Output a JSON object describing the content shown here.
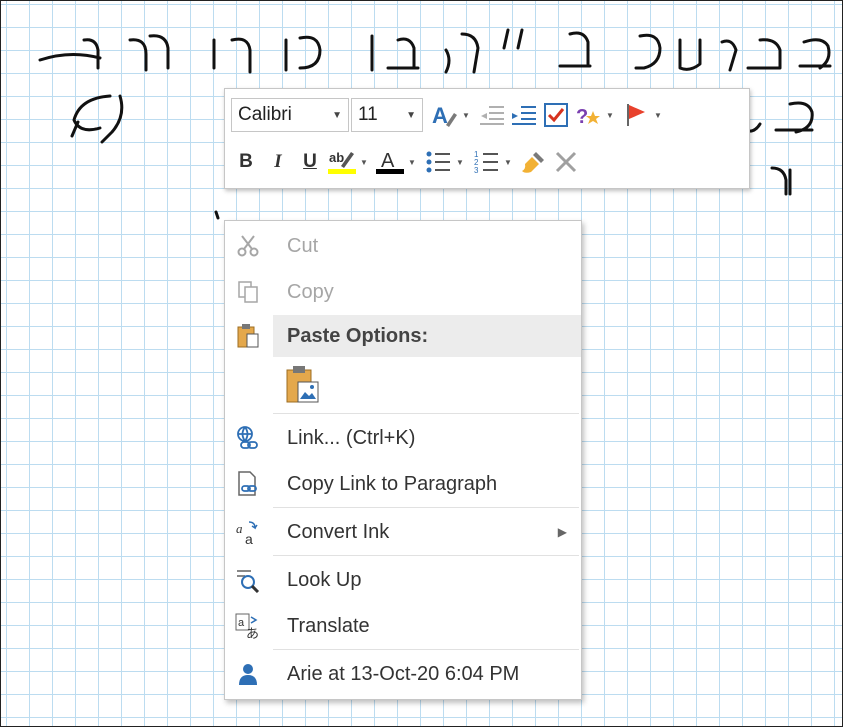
{
  "handwriting": {
    "line1": "כאשר הגל \"עת\" על נקודה מסוימת",
    "line2": "זמן ... בערך,",
    "line3": "מ ... ."
  },
  "mini_toolbar": {
    "font_name": "Calibri",
    "font_size": "11",
    "bold_label": "B",
    "italic_label": "I",
    "underline_label": "U",
    "highlight_color": "#ffff00",
    "font_color": "#000000",
    "flag_color": "#e8412c"
  },
  "context_menu": {
    "items": [
      {
        "label": "Cut",
        "enabled": false
      },
      {
        "label": "Copy",
        "enabled": false
      },
      {
        "label": "Paste Options:"
      },
      {
        "label": "Link... (Ctrl+K)",
        "enabled": true
      },
      {
        "label": "Copy Link to Paragraph",
        "enabled": true
      },
      {
        "label": "Convert Ink",
        "enabled": true
      },
      {
        "label": "Look Up",
        "enabled": true
      },
      {
        "label": "Translate",
        "enabled": true
      },
      {
        "label": "Arie at 13-Oct-20 6:04 PM",
        "enabled": true
      }
    ]
  },
  "colors": {
    "grid": "#bcdcf0",
    "accent_blue": "#2e6fb5",
    "disabled_text": "#a6a6a6",
    "menu_hover": "#ececec"
  }
}
